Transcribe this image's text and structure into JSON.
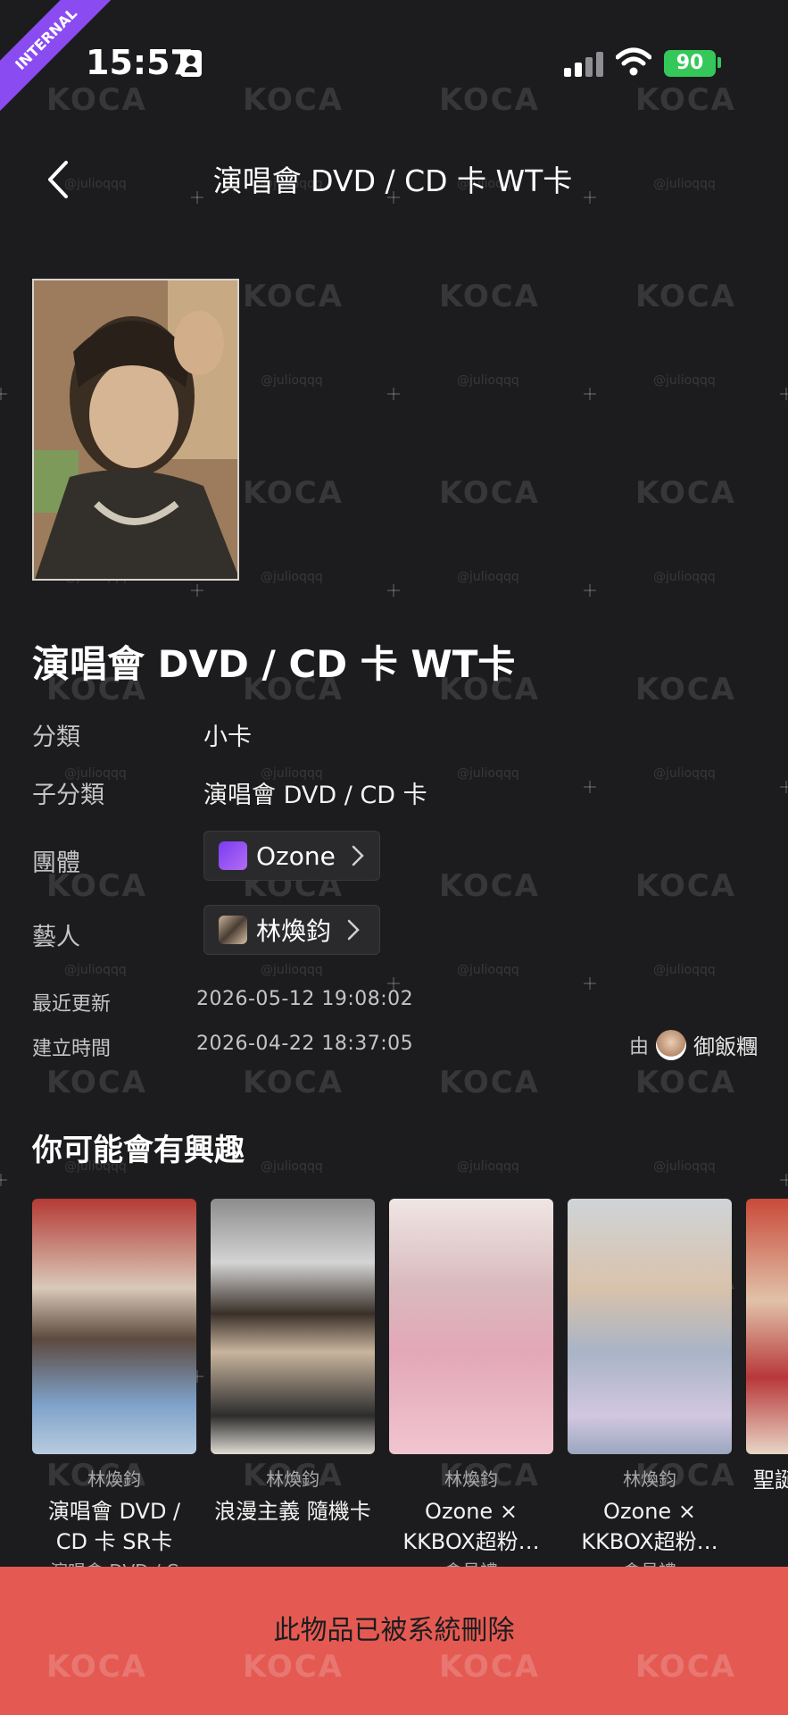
{
  "ribbon": "INTERNAL",
  "status_bar": {
    "time": "15:57",
    "battery": "90"
  },
  "nav": {
    "title": "演唱會 DVD / CD 卡 WT卡"
  },
  "item": {
    "title": "演唱會 DVD / CD 卡 WT卡",
    "fields": {
      "category_label": "分類",
      "category_value": "小卡",
      "subcategory_label": "子分類",
      "subcategory_value": "演唱會 DVD / CD 卡",
      "group_label": "團體",
      "group_value": "Ozone",
      "artist_label": "藝人",
      "artist_value": "林煥鈞"
    },
    "meta": {
      "updated_label": "最近更新",
      "updated_value": "2026-05-12 19:08:02",
      "created_label": "建立時間",
      "created_value": "2026-04-22 18:37:05",
      "by_label": "由",
      "by_user": "御飯糰"
    }
  },
  "recommendations": {
    "title": "你可能會有興趣",
    "items": [
      {
        "artist": "林煥鈞",
        "name": "演唱會 DVD / CD 卡 SR卡",
        "sub": "演唱會 DVD / C"
      },
      {
        "artist": "林煥鈞",
        "name": "浪漫主義 隨機卡",
        "sub": ""
      },
      {
        "artist": "林煥鈞",
        "name": "Ozone × KKBOX超粉…",
        "sub": "會員禮"
      },
      {
        "artist": "林煥鈞",
        "name": "Ozone × KKBOX超粉…",
        "sub": "會員禮"
      },
      {
        "artist": "",
        "name": "聖誕 卡",
        "sub": ""
      }
    ]
  },
  "banner": {
    "text": "此物品已被系統刪除"
  },
  "watermark": {
    "logo": "KOCA",
    "handle": "@julioqqq"
  },
  "colors": {
    "background": "#1c1c1e",
    "banner": "#e45a52",
    "ribbon": "#8a4cf1",
    "battery": "#34c759"
  }
}
